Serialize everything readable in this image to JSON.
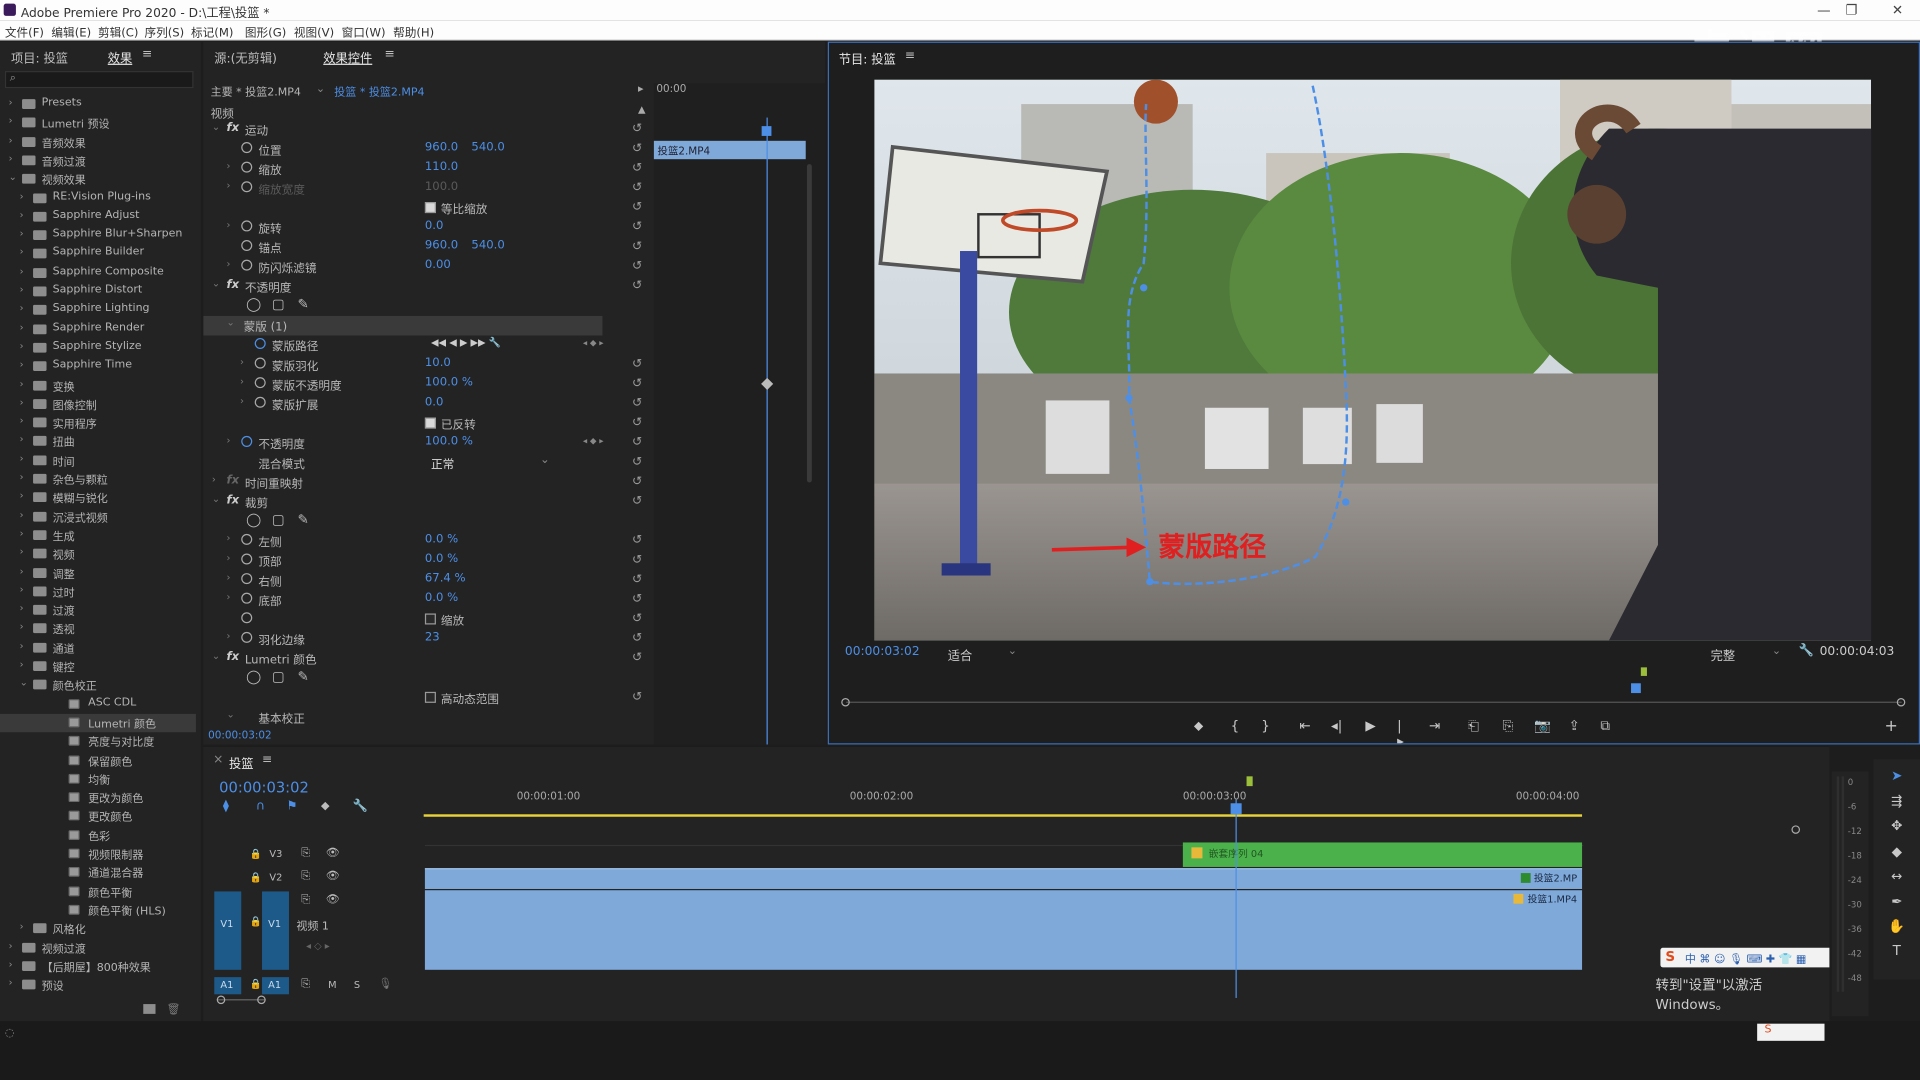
{
  "window": {
    "title": "Adobe Premiere Pro 2020 - D:\\工程\\投篮 *",
    "watermark": "虎课网"
  },
  "menu": [
    "文件(F)",
    "编辑(E)",
    "剪辑(C)",
    "序列(S)",
    "标记(M)",
    "图形(G)",
    "视图(V)",
    "窗口(W)",
    "帮助(H)"
  ],
  "left_panel": {
    "tab_project": "项目: 投篮",
    "tab_effects": "效果",
    "items": [
      {
        "label": "Presets",
        "level": 0
      },
      {
        "label": "Lumetri 预设",
        "level": 0
      },
      {
        "label": "音频效果",
        "level": 0
      },
      {
        "label": "音频过渡",
        "level": 0
      },
      {
        "label": "视频效果",
        "level": 0,
        "open": true
      },
      {
        "label": "RE:Vision Plug-ins",
        "level": 1
      },
      {
        "label": "Sapphire Adjust",
        "level": 1
      },
      {
        "label": "Sapphire Blur+Sharpen",
        "level": 1
      },
      {
        "label": "Sapphire Builder",
        "level": 1
      },
      {
        "label": "Sapphire Composite",
        "level": 1
      },
      {
        "label": "Sapphire Distort",
        "level": 1
      },
      {
        "label": "Sapphire Lighting",
        "level": 1
      },
      {
        "label": "Sapphire Render",
        "level": 1
      },
      {
        "label": "Sapphire Stylize",
        "level": 1
      },
      {
        "label": "Sapphire Time",
        "level": 1
      },
      {
        "label": "变换",
        "level": 1
      },
      {
        "label": "图像控制",
        "level": 1
      },
      {
        "label": "实用程序",
        "level": 1
      },
      {
        "label": "扭曲",
        "level": 1
      },
      {
        "label": "时间",
        "level": 1
      },
      {
        "label": "杂色与颗粒",
        "level": 1
      },
      {
        "label": "模糊与锐化",
        "level": 1
      },
      {
        "label": "沉浸式视频",
        "level": 1
      },
      {
        "label": "生成",
        "level": 1
      },
      {
        "label": "视频",
        "level": 1
      },
      {
        "label": "调整",
        "level": 1
      },
      {
        "label": "过时",
        "level": 1
      },
      {
        "label": "过渡",
        "level": 1
      },
      {
        "label": "透视",
        "level": 1
      },
      {
        "label": "通道",
        "level": 1
      },
      {
        "label": "键控",
        "level": 1
      },
      {
        "label": "颜色校正",
        "level": 1,
        "open": true
      },
      {
        "label": "ASC CDL",
        "level": 2
      },
      {
        "label": "Lumetri 颜色",
        "level": 2,
        "selected": true
      },
      {
        "label": "亮度与对比度",
        "level": 2
      },
      {
        "label": "保留颜色",
        "level": 2
      },
      {
        "label": "均衡",
        "level": 2
      },
      {
        "label": "更改为颜色",
        "level": 2
      },
      {
        "label": "更改颜色",
        "level": 2
      },
      {
        "label": "色彩",
        "level": 2
      },
      {
        "label": "视频限制器",
        "level": 2
      },
      {
        "label": "通道混合器",
        "level": 2
      },
      {
        "label": "颜色平衡",
        "level": 2
      },
      {
        "label": "颜色平衡 (HLS)",
        "level": 2
      },
      {
        "label": "风格化",
        "level": 1
      },
      {
        "label": "视频过渡",
        "level": 0
      },
      {
        "label": "【后期屋】800种效果",
        "level": 0
      },
      {
        "label": "预设",
        "level": 0
      }
    ]
  },
  "effect_controls": {
    "tab_source": "源:(无剪辑)",
    "tab_ec": "效果控件",
    "master": "主要 * 投篮2.MP4",
    "clip": "投篮 * 投篮2.MP4",
    "time_start": "00:00",
    "clip_bar_label": "投篮2.MP4",
    "section_video": "视频",
    "footer_time": "00:00:03:02",
    "rows": [
      {
        "type": "fx",
        "label": "运动"
      },
      {
        "type": "prop",
        "label": "位置",
        "v1": "960.0",
        "v2": "540.0"
      },
      {
        "type": "prop",
        "label": "缩放",
        "v1": "110.0",
        "arrow": true
      },
      {
        "type": "prop",
        "label": "缩放宽度",
        "v1": "100.0",
        "dim": true,
        "arrow": true
      },
      {
        "type": "check",
        "label": "等比缩放",
        "checked": true
      },
      {
        "type": "prop",
        "label": "旋转",
        "v1": "0.0",
        "arrow": true
      },
      {
        "type": "prop",
        "label": "锚点",
        "v1": "960.0",
        "v2": "540.0"
      },
      {
        "type": "prop",
        "label": "防闪烁滤镜",
        "v1": "0.00",
        "arrow": true
      },
      {
        "type": "fx",
        "label": "不透明度"
      },
      {
        "type": "shapes"
      },
      {
        "type": "mask",
        "label": "蒙版 (1)"
      },
      {
        "type": "maskpath",
        "label": "蒙版路径"
      },
      {
        "type": "subprop",
        "label": "蒙版羽化",
        "v1": "10.0"
      },
      {
        "type": "subprop",
        "label": "蒙版不透明度",
        "v1": "100.0 %"
      },
      {
        "type": "subprop",
        "label": "蒙版扩展",
        "v1": "0.0"
      },
      {
        "type": "check",
        "label": "已反转",
        "checked": true
      },
      {
        "type": "prop",
        "label": "不透明度",
        "v1": "100.0 %",
        "arrow": true,
        "blue": true
      },
      {
        "type": "select",
        "label": "混合模式",
        "v1": "正常"
      },
      {
        "type": "fx",
        "label": "时间重映射",
        "dimfx": true,
        "collapsed": true
      },
      {
        "type": "fx",
        "label": "裁剪"
      },
      {
        "type": "shapes"
      },
      {
        "type": "prop",
        "label": "左侧",
        "v1": "0.0 %",
        "arrow": true
      },
      {
        "type": "prop",
        "label": "顶部",
        "v1": "0.0 %",
        "arrow": true
      },
      {
        "type": "prop",
        "label": "右侧",
        "v1": "67.4 %",
        "arrow": true
      },
      {
        "type": "prop",
        "label": "底部",
        "v1": "0.0 %",
        "arrow": true
      },
      {
        "type": "check",
        "label": "缩放",
        "checked": false,
        "sw": true
      },
      {
        "type": "prop",
        "label": "羽化边缘",
        "v1": "23",
        "arrow": true
      },
      {
        "type": "fx",
        "label": "Lumetri 颜色"
      },
      {
        "type": "shapes"
      },
      {
        "type": "check",
        "label": "高动态范围",
        "checked": false
      },
      {
        "type": "sub",
        "label": "基本校正"
      }
    ]
  },
  "program": {
    "title": "节目: 投篮",
    "annotation": "蒙版路径",
    "timecode": "00:00:03:02",
    "fit": "适合",
    "quality": "完整",
    "duration": "00:00:04:03"
  },
  "timeline": {
    "title": "投篮",
    "timecode": "00:00:03:02",
    "ruler": [
      "00:00:01:00",
      "00:00:02:00",
      "00:00:03:00",
      "00:00:04:00"
    ],
    "tracks": {
      "v3": "V3",
      "v2": "V2",
      "v1": "V1",
      "a1": "A1",
      "v1_name": "视频 1",
      "m": "M",
      "s": "S"
    },
    "clips": {
      "nest": "嵌套序列 04",
      "clip2": "投篮2.MP",
      "clip1": "投篮1.MP4"
    },
    "activation": "转到\"设置\"以激活 Windows。",
    "meter_scale": [
      "0",
      "-6",
      "-12",
      "-18",
      "-24",
      "-30",
      "-36",
      "-42",
      "-48"
    ]
  },
  "colors": {
    "accent": "#4d8fe6",
    "green_clip": "#4bb24b",
    "blue_clip": "#7fa9d9",
    "annotation_red": "#e02020"
  }
}
